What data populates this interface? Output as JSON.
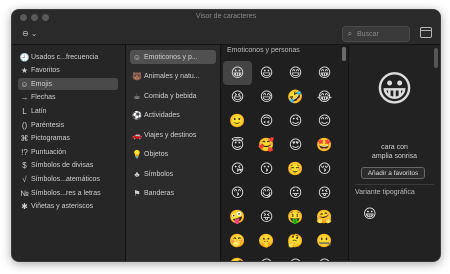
{
  "window": {
    "title": "Visor de caracteres"
  },
  "toolbar": {
    "menu_icon": "ellipsis-circle-icon",
    "search_placeholder": "Buscar",
    "search_icon": "search-icon",
    "panel_icon": "sidebar-toggle-icon"
  },
  "sidebar": {
    "items": [
      {
        "label": "Usados c...frecuencia",
        "icon": "🕘"
      },
      {
        "label": "Favoritos",
        "icon": "★"
      },
      {
        "label": "Emojis",
        "icon": "☺",
        "selected": true
      },
      {
        "label": "Flechas",
        "icon": "→"
      },
      {
        "label": "Latín",
        "icon": "L"
      },
      {
        "label": "Paréntesis",
        "icon": "()"
      },
      {
        "label": "Pictogramas",
        "icon": "⌘"
      },
      {
        "label": "Puntuación",
        "icon": "!?"
      },
      {
        "label": "Símbolos de divisas",
        "icon": "$"
      },
      {
        "label": "Símbolos...atemáticos",
        "icon": "√"
      },
      {
        "label": "Símbolos...res a letras",
        "icon": "№"
      },
      {
        "label": "Viñetas y asteriscos",
        "icon": "✱"
      }
    ]
  },
  "categories": {
    "items": [
      {
        "label": "Emoticonos y p...",
        "icon": "☺",
        "selected": true
      },
      {
        "label": "Animales y natu...",
        "icon": "🐻"
      },
      {
        "label": "Comida y bebida",
        "icon": "☕"
      },
      {
        "label": "Actividades",
        "icon": "⚽"
      },
      {
        "label": "Viajes y destinos",
        "icon": "🚗"
      },
      {
        "label": "Objetos",
        "icon": "💡"
      },
      {
        "label": "Símbolos",
        "icon": "♣"
      },
      {
        "label": "Banderas",
        "icon": "⚑"
      }
    ]
  },
  "grid": {
    "header": "Emoticonos y personas",
    "emojis": [
      "😀",
      "😃",
      "😄",
      "😁",
      "😆",
      "😅",
      "🤣",
      "😂",
      "🙂",
      "🙃",
      "😉",
      "😊",
      "😇",
      "🥰",
      "😍",
      "🤩",
      "😘",
      "😗",
      "☺️",
      "😚",
      "😙",
      "😋",
      "😛",
      "😜",
      "🤪",
      "😝",
      "🤑",
      "🤗",
      "🤭",
      "🤫",
      "🤔",
      "🤐",
      "🤨",
      "😐",
      "😑",
      "😶"
    ]
  },
  "detail": {
    "emoji": "😀",
    "description_line1": "cara con",
    "description_line2": "amplia sonrisa",
    "favorite_button": "Añadir a favoritos",
    "variant_label": "Variante tipográfica",
    "variant_emoji": "😀"
  }
}
